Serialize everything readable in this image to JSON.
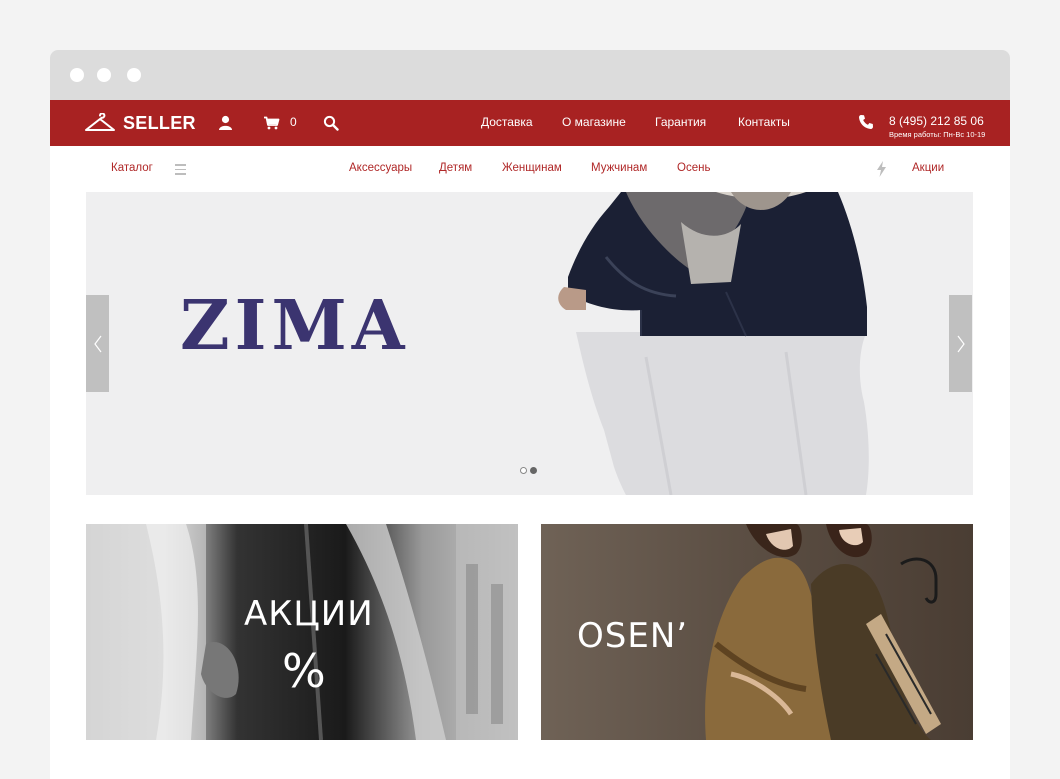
{
  "brand": {
    "name": "SELLER"
  },
  "header": {
    "cart_count": "0",
    "nav": [
      "Доставка",
      "О магазине",
      "Гарантия",
      "Контакты"
    ],
    "phone": "8 (495) 212 85 06",
    "hours": "Время работы: Пн-Вс 10-19"
  },
  "catbar": {
    "catalog": "Каталог",
    "categories": [
      "Аксессуары",
      "Детям",
      "Женщинам",
      "Мужчинам",
      "Осень"
    ],
    "promo_link": "Акции"
  },
  "slider": {
    "title": "ZIMA",
    "slide_count": 2,
    "active_slide": 2
  },
  "promos": [
    {
      "title": "АКЦИИ",
      "subtitle": "%"
    },
    {
      "title": "OSEN’"
    }
  ],
  "colors": {
    "brand": "#a82222",
    "link": "#b02828",
    "headline": "#3b3470",
    "page_bg": "#f3f3f3",
    "chrome": "#dcdcdc"
  },
  "icons": [
    "hanger-icon",
    "user-icon",
    "cart-icon",
    "search-icon",
    "phone-icon",
    "menu-icon",
    "lightning-icon",
    "chevron-left-icon",
    "chevron-right-icon"
  ]
}
